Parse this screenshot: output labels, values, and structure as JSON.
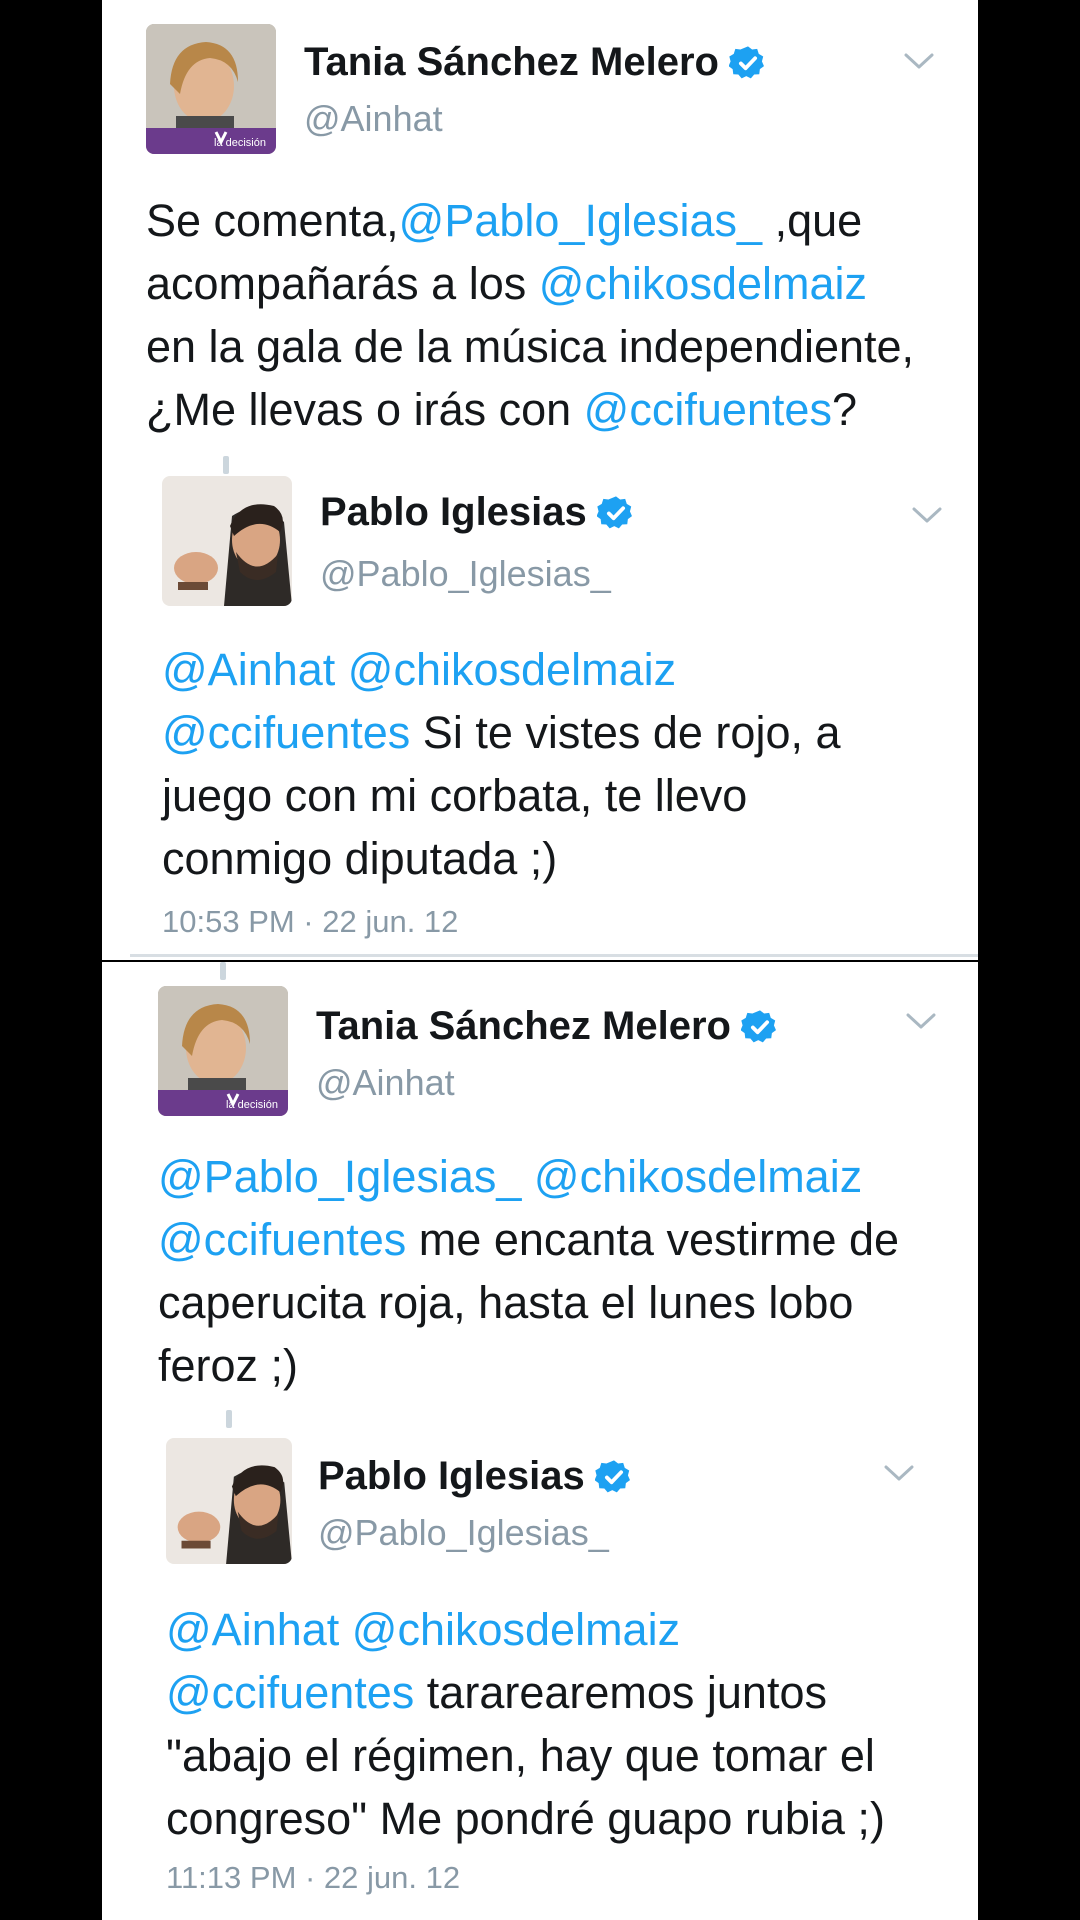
{
  "tweets": [
    {
      "author": "Tania Sánchez Melero",
      "handle": "@Ainhat",
      "lines": [
        [
          {
            "t": "Se comenta,",
            "m": false
          },
          {
            "t": "@Pablo_Iglesias_",
            "m": true
          },
          {
            "t": " ,que",
            "m": false
          }
        ],
        [
          {
            "t": "acompañarás a los ",
            "m": false
          },
          {
            "t": "@chikosdelmaiz",
            "m": true
          }
        ],
        [
          {
            "t": "en la gala de la música independiente,",
            "m": false
          }
        ],
        [
          {
            "t": "¿Me llevas o irás con ",
            "m": false
          },
          {
            "t": "@ccifuentes",
            "m": true
          },
          {
            "t": "?",
            "m": false
          }
        ]
      ]
    },
    {
      "author": "Pablo Iglesias",
      "handle": "@Pablo_Iglesias_",
      "lines": [
        [
          {
            "t": "@Ainhat @chikosdelmaiz",
            "m": true
          }
        ],
        [
          {
            "t": "@ccifuentes",
            "m": true
          },
          {
            "t": " Si te vistes de rojo, a",
            "m": false
          }
        ],
        [
          {
            "t": "juego con mi corbata, te llevo",
            "m": false
          }
        ],
        [
          {
            "t": "conmigo diputada ;)",
            "m": false
          }
        ]
      ],
      "timestamp": "10:53 PM · 22 jun. 12"
    },
    {
      "author": "Tania Sánchez Melero",
      "handle": "@Ainhat",
      "lines": [
        [
          {
            "t": "@Pablo_Iglesias_ @chikosdelmaiz",
            "m": true
          }
        ],
        [
          {
            "t": "@ccifuentes",
            "m": true
          },
          {
            "t": " me encanta vestirme de",
            "m": false
          }
        ],
        [
          {
            "t": "caperucita roja, hasta el lunes lobo",
            "m": false
          }
        ],
        [
          {
            "t": "feroz ;)",
            "m": false
          }
        ]
      ]
    },
    {
      "author": "Pablo Iglesias",
      "handle": "@Pablo_Iglesias_",
      "lines": [
        [
          {
            "t": "@Ainhat @chikosdelmaiz",
            "m": true
          }
        ],
        [
          {
            "t": "@ccifuentes",
            "m": true
          },
          {
            "t": " tararearemos juntos",
            "m": false
          }
        ],
        [
          {
            "t": "\"abajo el régimen, hay que tomar el",
            "m": false
          }
        ],
        [
          {
            "t": "congreso\" Me pondré guapo rubia ;)",
            "m": false
          }
        ]
      ],
      "timestamp": "11:13 PM · 22 jun. 12"
    }
  ],
  "colors": {
    "mention": "#1da1f2",
    "verified": "#1da1f2",
    "text": "#14171a",
    "muted": "#8899a6",
    "avatar_banner": "#6b3b8c"
  },
  "icons": {
    "verified": "verified-badge-icon",
    "menu": "chevron-down-icon"
  }
}
